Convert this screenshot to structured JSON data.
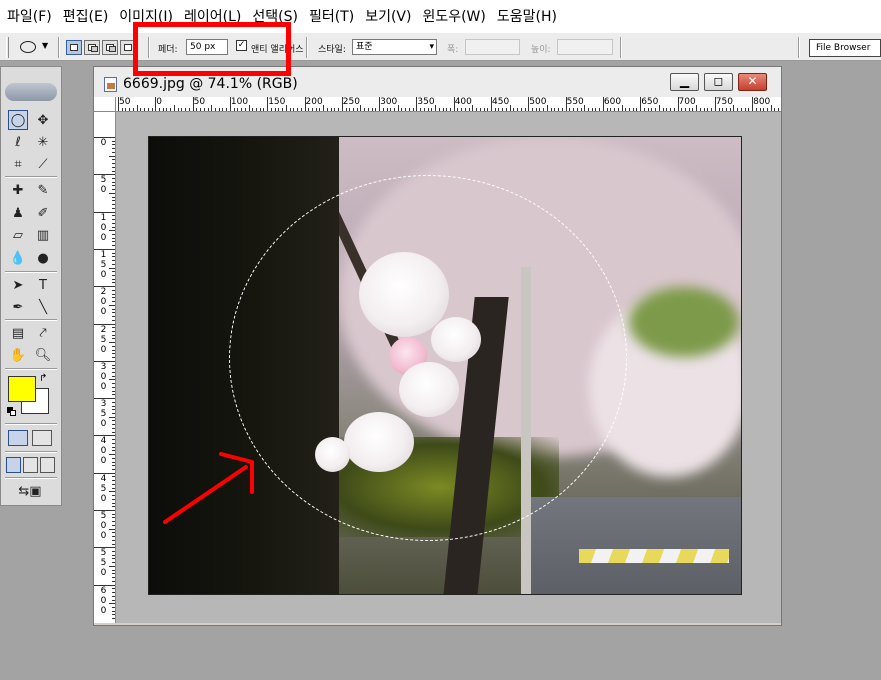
{
  "menu": [
    "파일(F)",
    "편집(E)",
    "이미지(I)",
    "레이어(L)",
    "선택(S)",
    "필터(T)",
    "보기(V)",
    "윈도우(W)",
    "도움말(H)"
  ],
  "options": {
    "feather_label": "페더:",
    "feather_value": "50 px",
    "antialias_label": "앤티 앨리어스",
    "antialias_checked": true,
    "style_label": "스타일:",
    "style_value": "표준",
    "width_label": "폭:",
    "height_label": "높이:",
    "file_browser": "File Browser"
  },
  "toolbox": {
    "foreground_color": "#ffff00",
    "background_color": "#ffffff"
  },
  "document": {
    "title": "6669.jpg @ 74.1% (RGB)",
    "zoom_percent": 74.1,
    "h_ruler": [
      "50",
      "0",
      "50",
      "100",
      "150",
      "200",
      "250",
      "300",
      "350",
      "400",
      "450",
      "500",
      "550",
      "600",
      "650",
      "700",
      "750",
      "800"
    ],
    "v_ruler": [
      "0",
      "50",
      "100",
      "150",
      "200",
      "250",
      "300",
      "350",
      "400",
      "450",
      "500",
      "550",
      "600"
    ]
  },
  "annotation": {
    "highlight_color": "#ff0000"
  }
}
